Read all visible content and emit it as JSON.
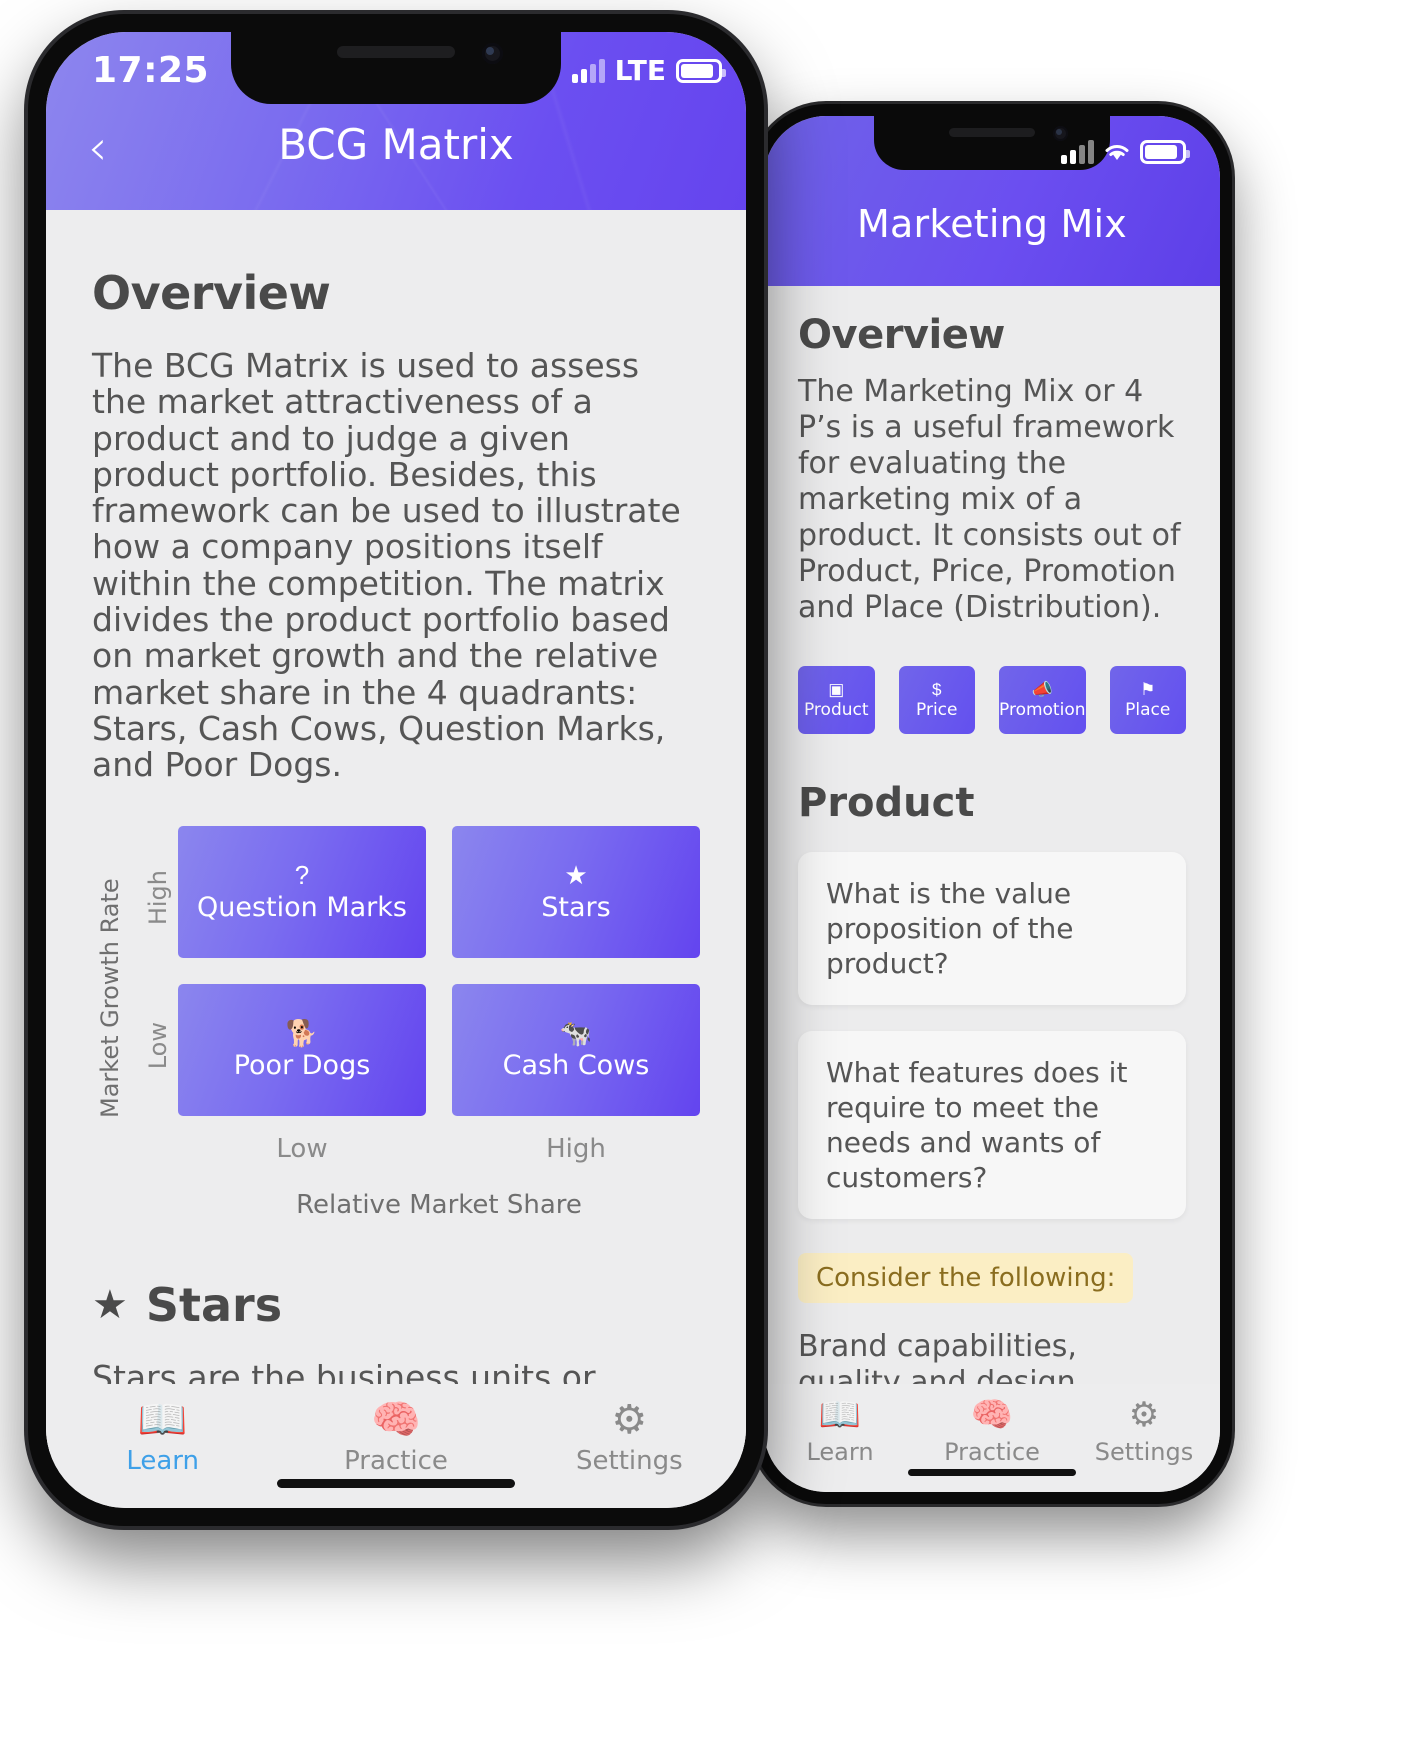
{
  "colors": {
    "accent_purple": "#6b4ff1",
    "accent_purple_light": "#8d86ee",
    "screen_bg": "#ededee",
    "tab_active": "#3ea0e8",
    "note_bg": "#fbeec4",
    "note_text": "#8a6d1f"
  },
  "phone_back": {
    "status": {
      "signal_icon": "cellular-bars-icon",
      "wifi_icon": "wifi-icon",
      "battery_icon": "battery-icon"
    },
    "header": {
      "title": "Marketing Mix"
    },
    "content": {
      "heading": "Overview",
      "paragraph": "The Marketing Mix or 4 P’s is a useful framework for evaluating the marketing mix of a product. It consists out of Product, Price, Promotion and Place (Distribution).",
      "pills": [
        {
          "icon": "product-box-icon",
          "glyph": "▣",
          "label": "Product"
        },
        {
          "icon": "dollar-icon",
          "glyph": "$",
          "label": "Price"
        },
        {
          "icon": "megaphone-icon",
          "glyph": "📣",
          "label": "Promotion"
        },
        {
          "icon": "location-pin-icon",
          "glyph": "⚑",
          "label": "Place"
        }
      ],
      "section_heading": "Product",
      "cards": [
        "What is the value proposition of the product?",
        "What features does it require to meet the needs and wants of customers?"
      ],
      "note": "Consider the following:",
      "tail": "Brand capabilities, quality and design, service and warranties, styling and sizing, positioning and segmentation, differntiated"
    },
    "tabs": [
      {
        "icon": "book-icon",
        "glyph": "📖",
        "label": "Learn"
      },
      {
        "icon": "brain-icon",
        "glyph": "🧠",
        "label": "Practice"
      },
      {
        "icon": "gear-icon",
        "glyph": "⚙",
        "label": "Settings"
      }
    ]
  },
  "phone_front": {
    "status": {
      "time": "17:25",
      "network": "LTE",
      "signal_icon": "cellular-bars-icon",
      "battery_icon": "battery-icon"
    },
    "header": {
      "back_icon": "chevron-left-icon",
      "back_glyph": "‹",
      "title": "BCG Matrix"
    },
    "content": {
      "heading": "Overview",
      "paragraph": "The BCG Matrix is used to assess the market attractiveness of a product and to judge a given product portfolio. Besides, this framework can be used to illustrate how a company positions itself within the competition. The matrix divides the product portfolio based on market growth and the relative market share in the 4 quadrants: Stars, Cash Cows, Question Marks, and Poor Dogs.",
      "section_heading": "Stars",
      "section_icon": "star-icon",
      "section_glyph": "★",
      "section_paragraph": "Stars are the business units or products that have the best market share and"
    },
    "tabs": [
      {
        "icon": "book-icon",
        "glyph": "📖",
        "label": "Learn",
        "active": true
      },
      {
        "icon": "brain-icon",
        "glyph": "🧠",
        "label": "Practice",
        "active": false
      },
      {
        "icon": "gear-icon",
        "glyph": "⚙",
        "label": "Settings",
        "active": false
      }
    ]
  },
  "chart_data": {
    "type": "table",
    "title": "BCG Matrix",
    "xlabel": "Relative Market Share",
    "ylabel": "Market Growth Rate",
    "x_ticks": [
      "Low",
      "High"
    ],
    "y_ticks": [
      "High",
      "Low"
    ],
    "quadrants": [
      {
        "row": "High",
        "col": "Low",
        "label": "Question Marks",
        "icon": "question-mark-icon",
        "glyph": "?"
      },
      {
        "row": "High",
        "col": "High",
        "label": "Stars",
        "icon": "star-icon",
        "glyph": "★"
      },
      {
        "row": "Low",
        "col": "Low",
        "label": "Poor Dogs",
        "icon": "dog-icon",
        "glyph": "🐕"
      },
      {
        "row": "Low",
        "col": "High",
        "label": "Cash Cows",
        "icon": "cow-icon",
        "glyph": "🐄"
      }
    ]
  }
}
